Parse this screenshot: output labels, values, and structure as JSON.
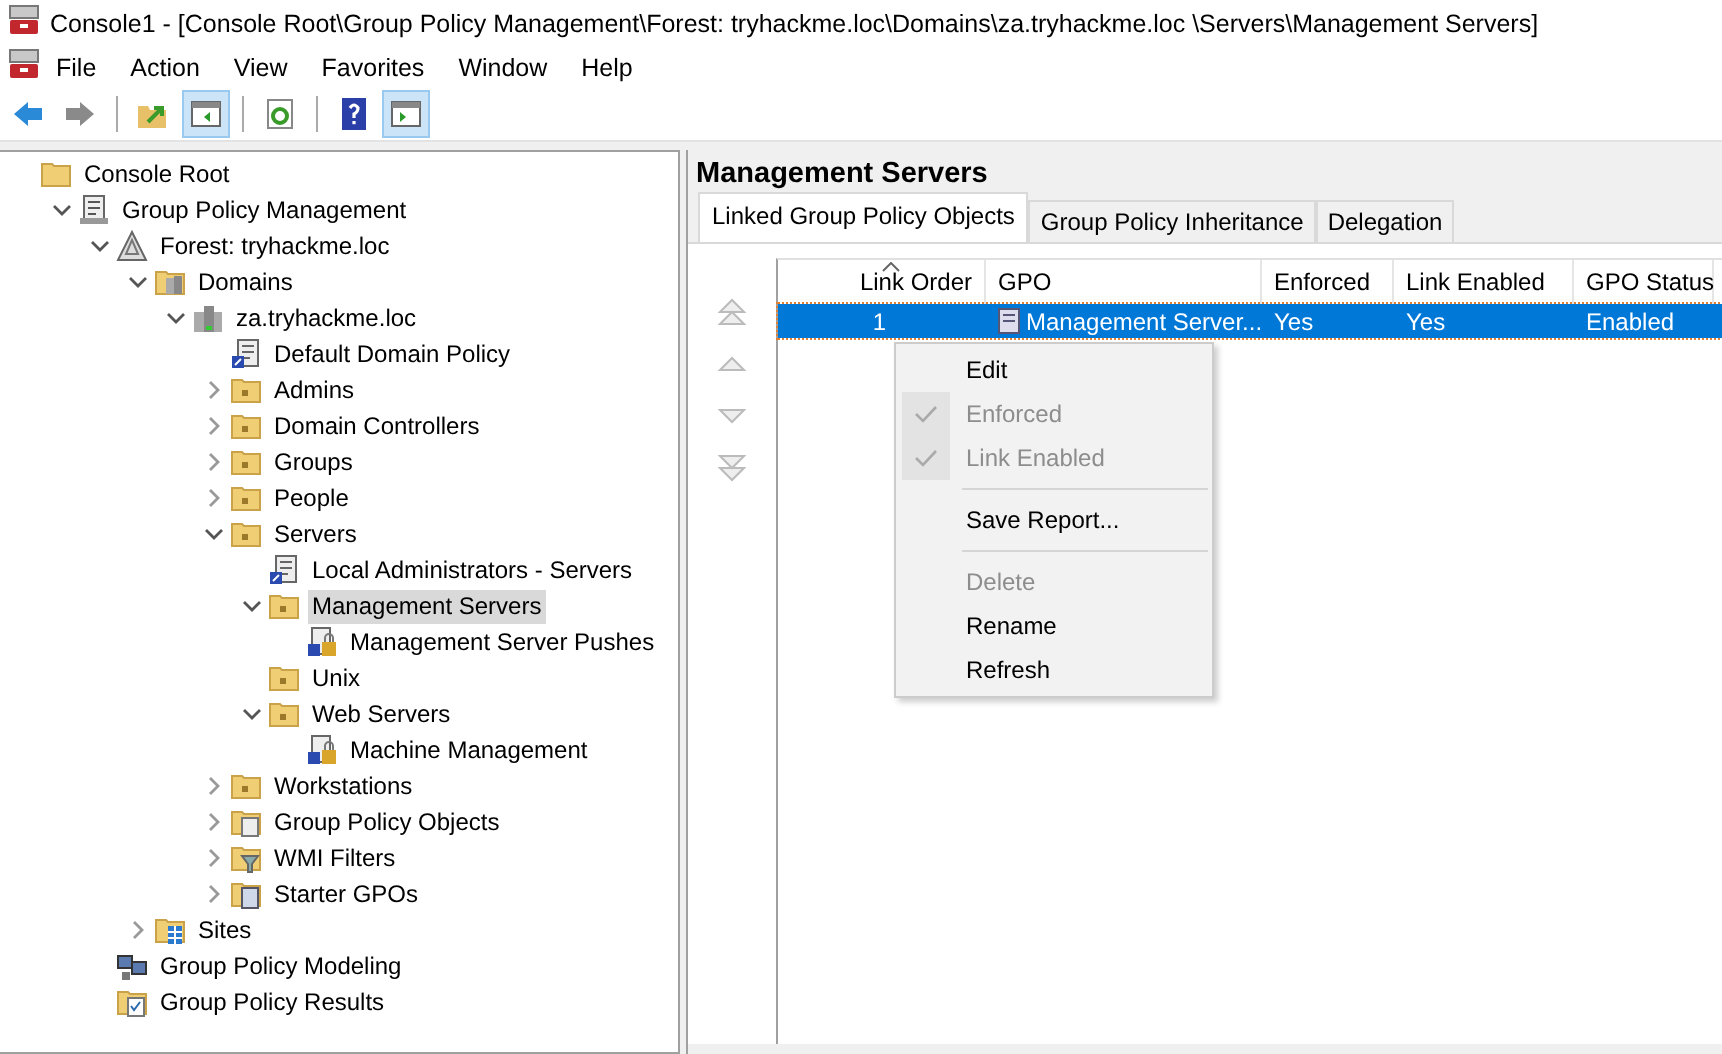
{
  "window": {
    "title": "Console1 - [Console Root\\Group Policy Management\\Forest: tryhackme.loc\\Domains\\za.tryhackme.loc \\Servers\\Management Servers]"
  },
  "menu_bar": [
    {
      "label": "File"
    },
    {
      "label": "Action"
    },
    {
      "label": "View"
    },
    {
      "label": "Favorites"
    },
    {
      "label": "Window"
    },
    {
      "label": "Help"
    }
  ],
  "toolbar": [
    {
      "kind": "back",
      "pressed": false
    },
    {
      "kind": "forward",
      "pressed": false
    },
    {
      "kind": "sep"
    },
    {
      "kind": "up",
      "pressed": false
    },
    {
      "kind": "tree",
      "pressed": true
    },
    {
      "kind": "sep"
    },
    {
      "kind": "refresh",
      "pressed": false
    },
    {
      "kind": "sep"
    },
    {
      "kind": "help",
      "pressed": false
    },
    {
      "kind": "action",
      "pressed": true
    }
  ],
  "tree": [
    {
      "label": "Console Root",
      "kind": "folder",
      "selected": false,
      "children": [
        {
          "label": "Group Policy Management",
          "kind": "gpm",
          "expanded": true,
          "selected": false,
          "children": [
            {
              "label": "Forest: tryhackme.loc",
              "kind": "forest",
              "expanded": true,
              "selected": false,
              "children": [
                {
                  "label": "Domains",
                  "kind": "domains",
                  "expanded": true,
                  "selected": false,
                  "children": [
                    {
                      "label": "za.tryhackme.loc",
                      "kind": "domain",
                      "expanded": true,
                      "selected": false,
                      "children": [
                        {
                          "label": "Default Domain Policy",
                          "kind": "link",
                          "selected": false
                        },
                        {
                          "label": "Admins",
                          "kind": "ou",
                          "expanded": false,
                          "selected": false
                        },
                        {
                          "label": "Domain Controllers",
                          "kind": "ou",
                          "expanded": false,
                          "selected": false
                        },
                        {
                          "label": "Groups",
                          "kind": "ou",
                          "expanded": false,
                          "selected": false
                        },
                        {
                          "label": "People",
                          "kind": "ou",
                          "expanded": false,
                          "selected": false
                        },
                        {
                          "label": "Servers",
                          "kind": "ou",
                          "expanded": true,
                          "selected": false,
                          "children": [
                            {
                              "label": "Local Administrators - Servers",
                              "kind": "link",
                              "selected": false
                            },
                            {
                              "label": "Management Servers",
                              "kind": "ou",
                              "expanded": true,
                              "selected": true,
                              "children": [
                                {
                                  "label": "Management Server Pushes",
                                  "kind": "locked",
                                  "selected": false
                                }
                              ]
                            },
                            {
                              "label": "Unix",
                              "kind": "ou",
                              "selected": false
                            },
                            {
                              "label": "Web Servers",
                              "kind": "ou",
                              "expanded": true,
                              "selected": false,
                              "children": [
                                {
                                  "label": "Machine Management",
                                  "kind": "locked",
                                  "selected": false
                                }
                              ]
                            }
                          ]
                        },
                        {
                          "label": "Workstations",
                          "kind": "ou",
                          "expanded": false,
                          "selected": false
                        },
                        {
                          "label": "Group Policy Objects",
                          "kind": "gpos",
                          "expanded": false,
                          "selected": false
                        },
                        {
                          "label": "WMI Filters",
                          "kind": "wmi",
                          "expanded": false,
                          "selected": false
                        },
                        {
                          "label": "Starter GPOs",
                          "kind": "starter",
                          "expanded": false,
                          "selected": false
                        }
                      ]
                    }
                  ]
                },
                {
                  "label": "Sites",
                  "kind": "sites",
                  "expanded": false,
                  "selected": false
                }
              ]
            },
            {
              "label": "Group Policy Modeling",
              "kind": "modeling",
              "selected": false
            },
            {
              "label": "Group Policy Results",
              "kind": "results",
              "selected": false
            }
          ]
        }
      ]
    }
  ],
  "details": {
    "title": "Management Servers",
    "tabs": [
      {
        "label": "Linked Group Policy Objects",
        "selected": true
      },
      {
        "label": "Group Policy Inheritance",
        "selected": false
      },
      {
        "label": "Delegation",
        "selected": false
      }
    ],
    "table": {
      "columns": [
        {
          "label": "Link Order",
          "sorted": true
        },
        {
          "label": "GPO",
          "sorted": false
        },
        {
          "label": "Enforced",
          "sorted": false
        },
        {
          "label": "Link Enabled",
          "sorted": false
        },
        {
          "label": "GPO Status",
          "sorted": false
        }
      ],
      "rows": [
        {
          "selected": true,
          "cells": [
            "1",
            "Management Server...",
            "Yes",
            "Yes",
            "Enabled"
          ]
        }
      ]
    }
  },
  "context_menu": [
    {
      "kind": "item",
      "label": "Edit",
      "disabled": false,
      "checked": false
    },
    {
      "kind": "item",
      "label": "Enforced",
      "disabled": true,
      "checked": true
    },
    {
      "kind": "item",
      "label": "Link Enabled",
      "disabled": true,
      "checked": true
    },
    {
      "kind": "separator"
    },
    {
      "kind": "item",
      "label": "Save Report...",
      "disabled": false,
      "checked": false
    },
    {
      "kind": "separator"
    },
    {
      "kind": "item",
      "label": "Delete",
      "disabled": true,
      "checked": false
    },
    {
      "kind": "item",
      "label": "Rename",
      "disabled": false,
      "checked": false
    },
    {
      "kind": "item",
      "label": "Refresh",
      "disabled": false,
      "checked": false
    }
  ]
}
